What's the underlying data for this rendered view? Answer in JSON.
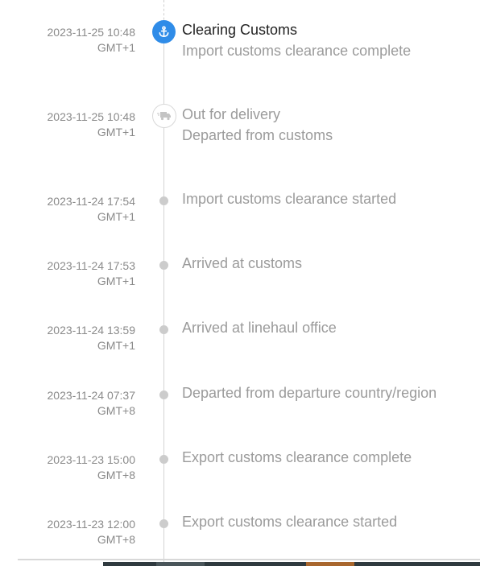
{
  "events": [
    {
      "date": "2023-11-25 10:48",
      "tz": "GMT+1",
      "title": "Clearing Customs",
      "detail": "Import customs clearance complete",
      "marker": "anchor-icon",
      "active": true
    },
    {
      "date": "2023-11-25 10:48",
      "tz": "GMT+1",
      "title": "Out for delivery",
      "detail": "Departed from customs",
      "marker": "truck-icon"
    },
    {
      "date": "2023-11-24 17:54",
      "tz": "GMT+1",
      "detail": "Import customs clearance started"
    },
    {
      "date": "2023-11-24 17:53",
      "tz": "GMT+1",
      "detail": "Arrived at customs"
    },
    {
      "date": "2023-11-24 13:59",
      "tz": "GMT+1",
      "detail": "Arrived at linehaul office"
    },
    {
      "date": "2023-11-24 07:37",
      "tz": "GMT+8",
      "detail": "Departed from departure country/region"
    },
    {
      "date": "2023-11-23 15:00",
      "tz": "GMT+8",
      "detail": "Export customs clearance complete"
    },
    {
      "date": "2023-11-23 12:00",
      "tz": "GMT+8",
      "detail": "Export customs clearance started"
    }
  ],
  "colors": {
    "accent": "#2f8ce8",
    "active_text": "#222222",
    "muted_text": "#9b9b9b",
    "date_text": "#8a8a8a",
    "dot": "#cccccc",
    "line": "#d4d4d4"
  }
}
